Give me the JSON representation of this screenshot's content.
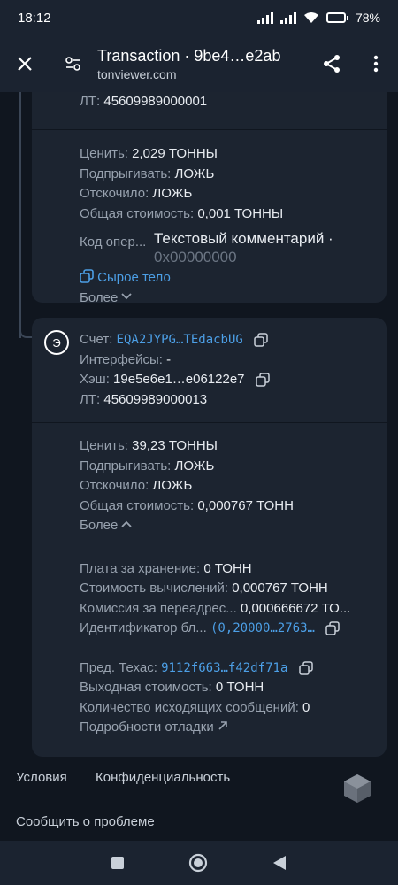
{
  "status": {
    "time": "18:12",
    "battery": "78",
    "battery_fraction": 0.78
  },
  "header": {
    "title": "Transaction · 9be4…e2ab",
    "subtitle": "tonviewer.com"
  },
  "card1": {
    "lt_label": "ЛТ:",
    "lt_value": "45609989000001",
    "value_label": "Ценить:",
    "value": "2,029 ТОННЫ",
    "bounce_label": "Подпрыгивать:",
    "bounce": "ЛОЖЬ",
    "bounced_label": "Отскочило:",
    "bounced": "ЛОЖЬ",
    "total_label": "Общая стоимость:",
    "total": "0,001 ТОННЫ",
    "opcode_label": "Код опер...",
    "opcode_text": "Текстовый комментарий ·",
    "opcode_hex": "0x00000000",
    "raw_body": "Сырое тело",
    "more": "Более"
  },
  "card2": {
    "avatar_letter": "Э",
    "account_label": "Счет:",
    "account": "EQA2JYPG…TEdacbUG",
    "interfaces_label": "Интерфейсы:",
    "interfaces": "-",
    "hash_label": "Хэш:",
    "hash": "19e5e6e1…e06122e7",
    "lt_label": "ЛТ:",
    "lt_value": "45609989000013",
    "value_label": "Ценить:",
    "value": "39,23 ТОННЫ",
    "bounce_label": "Подпрыгивать:",
    "bounce": "ЛОЖЬ",
    "bounced_label": "Отскочило:",
    "bounced": "ЛОЖЬ",
    "total_label": "Общая стоимость:",
    "total": "0,000767 ТОНН",
    "more": "Более",
    "storage_label": "Плата за хранение:",
    "storage": "0 ТОНН",
    "compute_label": "Стоимость вычислений:",
    "compute": "0,000767 ТОНН",
    "forward_label": "Комиссия за переадрес...",
    "forward": "0,000666672 ТО...",
    "block_label": "Идентификатор бл...",
    "block": "(0,20000…2763…",
    "prev_label": "Пред. Техас:",
    "prev": "9112f663…f42df71a",
    "out_label": "Выходная стоимость:",
    "out": "0 ТОНН",
    "outmsg_label": "Количество исходящих сообщений:",
    "outmsg": "0",
    "debug": "Подробности отладки"
  },
  "footer": {
    "terms": "Условия",
    "privacy": "Конфиденциальность",
    "report": "Сообщить о проблеме"
  },
  "colors": {
    "link": "#4c9fe6",
    "card": "#1c2430",
    "bg": "#10161f"
  }
}
